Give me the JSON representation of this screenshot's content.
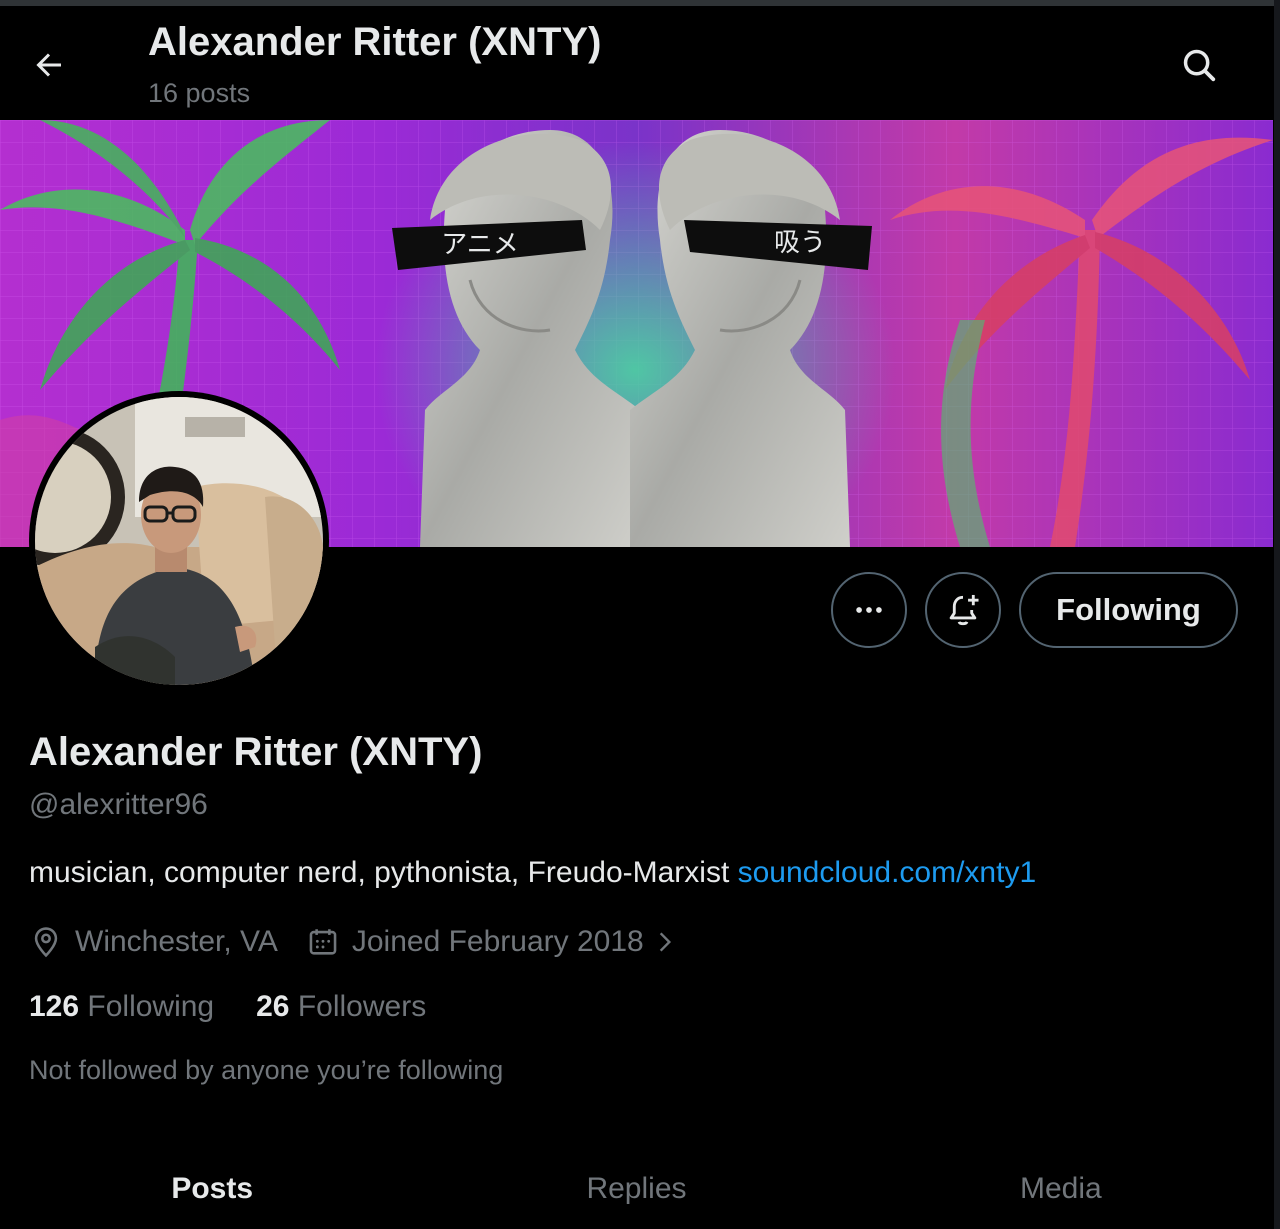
{
  "header": {
    "title": "Alexander Ritter (XNTY)",
    "post_count": "16 posts"
  },
  "icons": {
    "back": "arrow-left-icon",
    "search": "search-icon",
    "more": "more-horizontal-icon",
    "notify": "bell-plus-icon",
    "location": "location-pin-icon",
    "calendar": "calendar-icon",
    "chevron": "chevron-right-icon"
  },
  "banner": {
    "left_caption": "アニメ",
    "right_caption": "吸う"
  },
  "actions": {
    "follow_state_label": "Following"
  },
  "profile": {
    "display_name": "Alexander Ritter (XNTY)",
    "handle": "@alexritter96",
    "bio_text": "musician, computer nerd, pythonista, Freudo-Marxist ",
    "bio_link": "soundcloud.com/xnty1",
    "location": "Winchester, VA",
    "joined": "Joined February 2018",
    "following_count": "126",
    "following_label": " Following",
    "followers_count": "26",
    "followers_label": " Followers",
    "mutuals_note": "Not followed by anyone you’re following"
  },
  "tabs": [
    {
      "label": "Posts",
      "active": true
    },
    {
      "label": "Replies",
      "active": false
    },
    {
      "label": "Media",
      "active": false
    }
  ],
  "colors": {
    "background": "#000000",
    "text_primary": "#e7e9ea",
    "text_secondary": "#71767b",
    "link": "#1d9bf0",
    "border": "#536471"
  }
}
